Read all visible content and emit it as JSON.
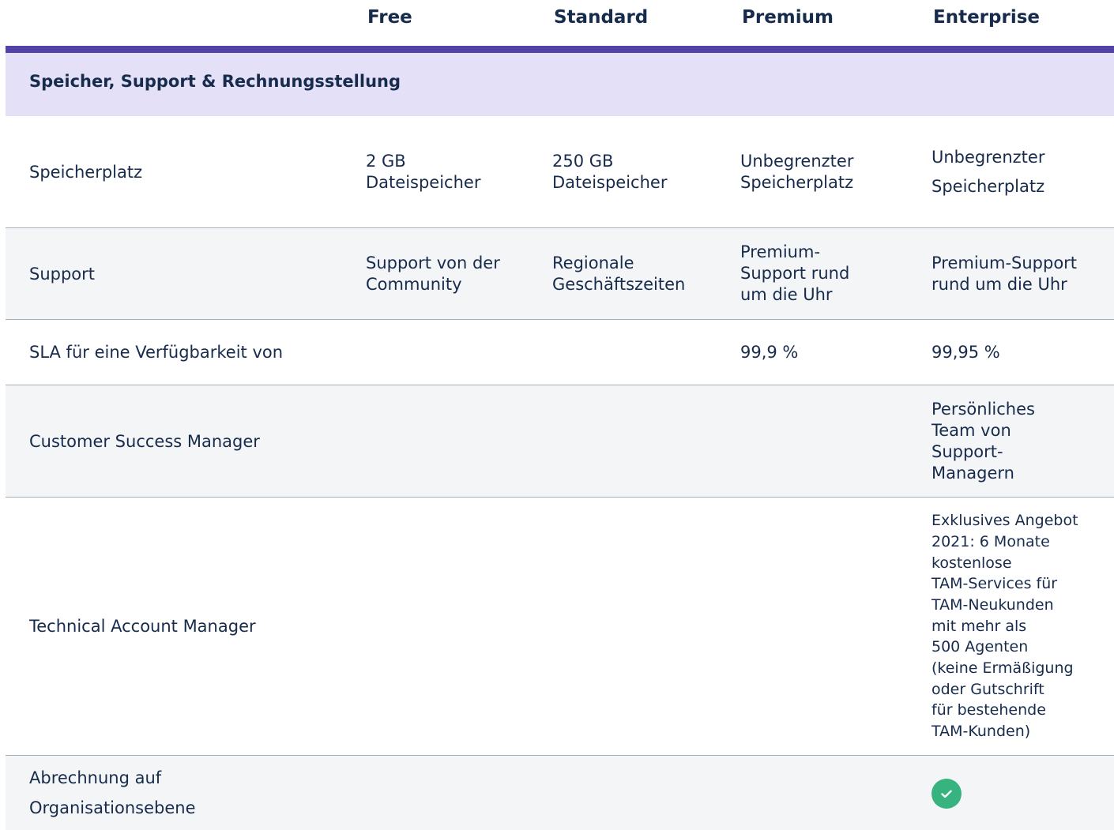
{
  "plans": {
    "free": "Free",
    "standard": "Standard",
    "premium": "Premium",
    "enterprise": "Enterprise"
  },
  "section": {
    "title": "Speicher, Support & Rechnungsstellung"
  },
  "rows": [
    {
      "label": "Speicherplatz",
      "free": "2 GB\nDateispeicher",
      "standard": "250 GB\nDateispeicher",
      "premium": "Unbegrenzter\nSpeicherplatz",
      "enterprise": "Unbegrenzter\nSpeicherplatz"
    },
    {
      "label": "Support",
      "free": "Support von der\nCommunity",
      "standard": "Regionale\nGeschäftszeiten",
      "premium": "Premium-\nSupport rund\num die Uhr",
      "enterprise": "Premium-Support\nrund um die Uhr"
    },
    {
      "label": "SLA für eine Verfügbarkeit von",
      "free": "",
      "standard": "",
      "premium": "99,9 %",
      "enterprise": "99,95 %"
    },
    {
      "label": "Customer Success Manager",
      "free": "",
      "standard": "",
      "premium": "",
      "enterprise": "Persönliches\nTeam von\nSupport-\nManagern"
    },
    {
      "label": "Technical Account Manager",
      "free": "",
      "standard": "",
      "premium": "",
      "enterprise": "Exklusives Angebot\n2021: 6 Monate\nkostenlose\nTAM-Services für\nTAM-Neukunden\nmit mehr als\n500 Agenten\n(keine Ermäßigung\noder Gutschrift\nfür bestehende\nTAM-Kunden)"
    },
    {
      "label": "Abrechnung auf\nOrganisationsebene",
      "free": "",
      "standard": "",
      "premium": "",
      "enterprise": ""
    }
  ],
  "icons": {
    "included": "check-circle-icon"
  },
  "colors": {
    "accent": "#5243aa",
    "section_bg": "#e3e0f7",
    "row_alt": "#f4f5f7",
    "text": "#172b4d",
    "check": "#36b37e"
  }
}
